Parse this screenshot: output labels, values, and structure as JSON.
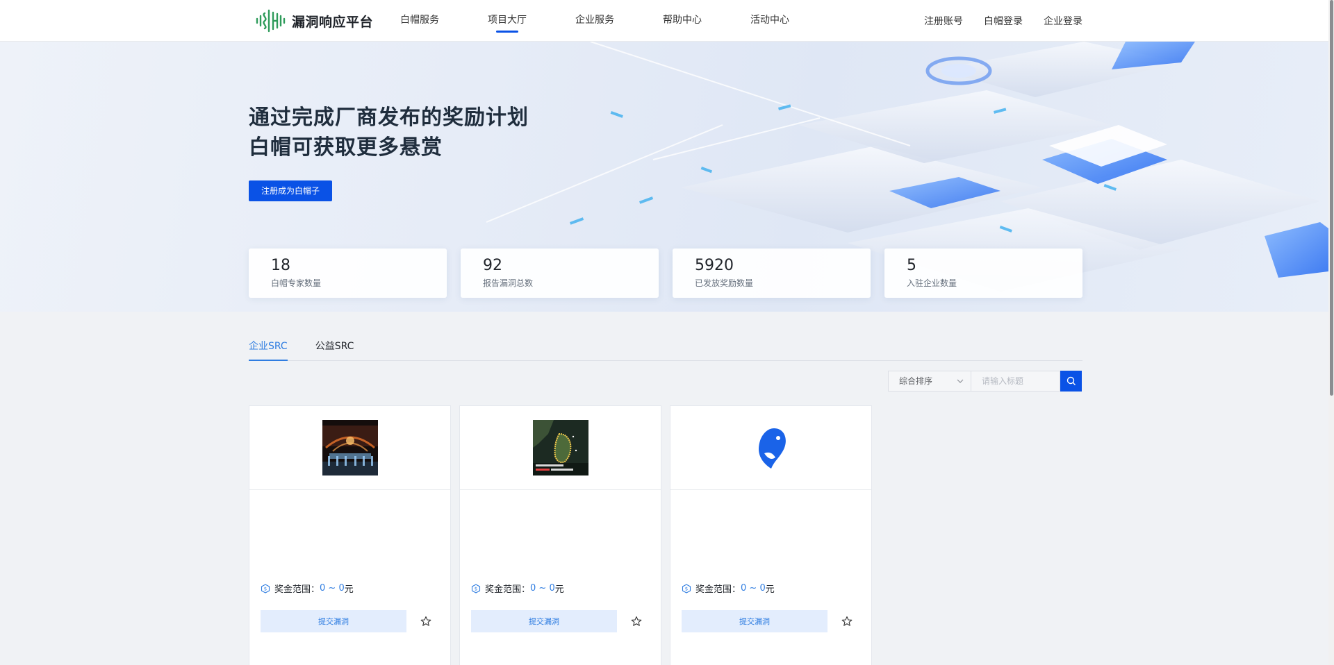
{
  "header": {
    "logo_text": "漏洞响应平台",
    "nav": [
      "白帽服务",
      "项目大厅",
      "企业服务",
      "帮助中心",
      "活动中心"
    ],
    "active_nav": "项目大厅",
    "right_links": [
      "注册账号",
      "白帽登录",
      "企业登录"
    ]
  },
  "hero": {
    "title_line1": "通过完成厂商发布的奖励计划",
    "title_line2": "白帽可获取更多悬赏",
    "cta_label": "注册成为白帽子",
    "stats": [
      {
        "value": "18",
        "label": "白帽专家数量"
      },
      {
        "value": "92",
        "label": "报告漏洞总数"
      },
      {
        "value": "5920",
        "label": "已发放奖励数量"
      },
      {
        "value": "5",
        "label": "入驻企业数量"
      }
    ]
  },
  "tabs": [
    "企业SRC",
    "公益SRC"
  ],
  "active_tab": "企业SRC",
  "filter": {
    "sort_value": "综合排序",
    "search_placeholder": "请输入标题"
  },
  "cards": [
    {
      "logo": "concert-stage-image",
      "bonus_label": "奖金范围：",
      "bonus_range": "0 ~ 0",
      "bonus_unit": "元",
      "submit_label": "提交漏洞"
    },
    {
      "logo": "island-map-image",
      "bonus_label": "奖金范围：",
      "bonus_range": "0 ~ 0",
      "bonus_unit": "元",
      "submit_label": "提交漏洞"
    },
    {
      "logo": "blue-bird-logo",
      "bonus_label": "奖金范围：",
      "bonus_range": "0 ~ 0",
      "bonus_unit": "元",
      "submit_label": "提交漏洞"
    }
  ],
  "colors": {
    "primary": "#0a52e6",
    "link": "#2f7de1",
    "logo_green": "#2e9b5a"
  }
}
